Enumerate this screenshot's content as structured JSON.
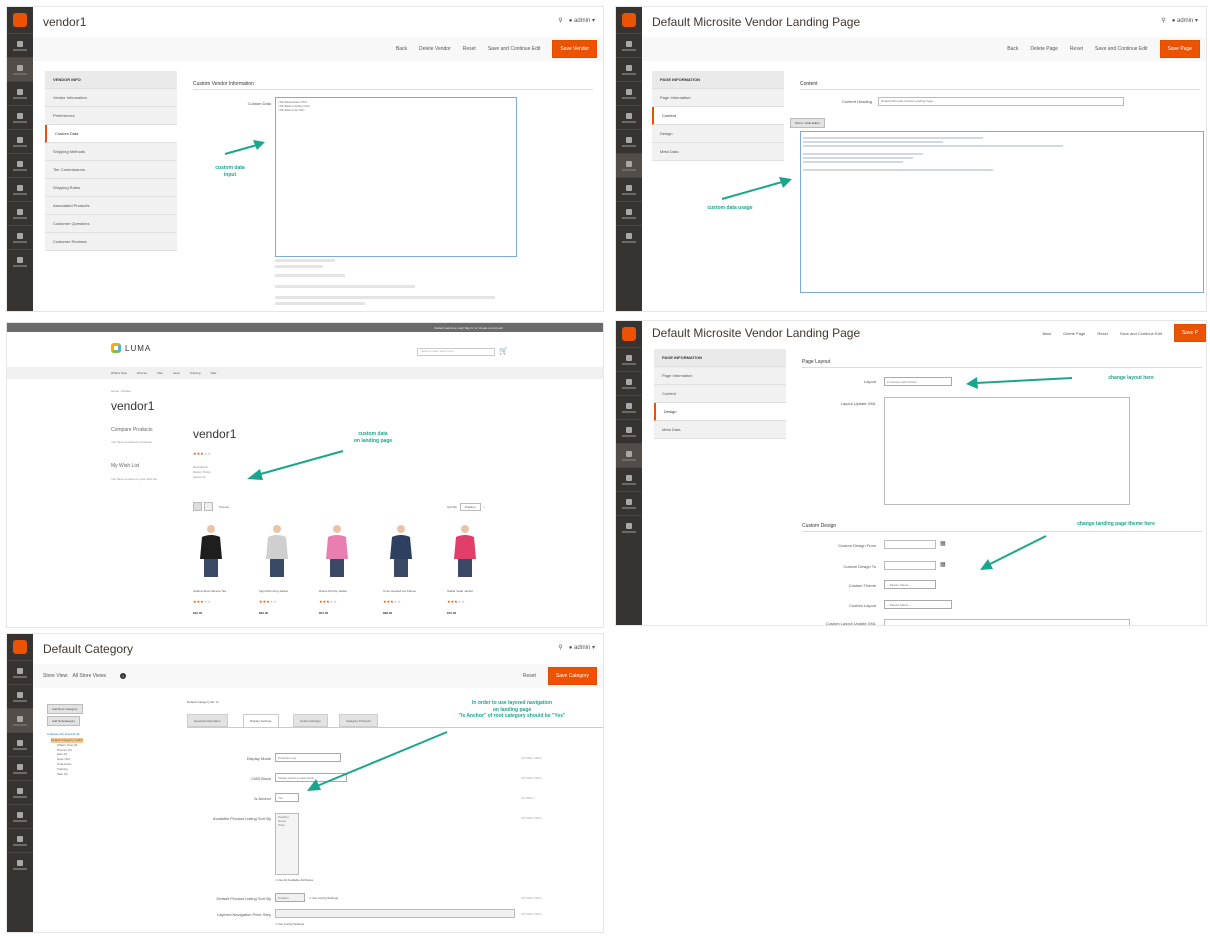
{
  "colors": {
    "accent": "#eb5202",
    "note": "#1aa68d",
    "sidebar": "#373330"
  },
  "p1": {
    "title": "vendor1",
    "actions": [
      "Back",
      "Delete Vendor",
      "Reset",
      "Save and Continue Edit",
      "Save Vendor"
    ],
    "tabs": [
      "Vendor Information",
      "Preferences",
      "Custom Data",
      "Shipping Methods",
      "Tier Commissions",
      "Shipping Rates",
      "Associated Products",
      "Customer Questions",
      "Customer Reviews"
    ],
    "section": "Custom Vendor Information",
    "field_label": "Custom Data",
    "textarea": "<h3>Description</h3>\n<h3>Return Policy</h3>\n<h3>About Us</h3>",
    "note": "custom data\ninput"
  },
  "p2": {
    "title": "Default Microsite Vendor Landing Page",
    "actions": [
      "Back",
      "Delete Page",
      "Reset",
      "Save and Continue Edit",
      "Save Page"
    ],
    "tabs": [
      "Page Information",
      "Content",
      "Design",
      "Meta Data"
    ],
    "section": "Content",
    "heading_label": "Content Heading",
    "heading_value": "Default Microsite Vendor Landing Page",
    "button": "Show / Hide Editor",
    "note": "custom data usage"
  },
  "p3": {
    "topbar": "Default welcome msg!  Sign In  or  Create an Account",
    "brand": "LUMA",
    "search_placeholder": "Search entire store here...",
    "nav": [
      "What's New",
      "Women",
      "Men",
      "Gear",
      "Training",
      "Sale"
    ],
    "breadcrumb": "Home  /  Vendor",
    "heading": "vendor1",
    "compare": "Compare Products",
    "compare_text": "You have no items to compare.",
    "wishlist": "My Wish List",
    "wishlist_text": "You have no items in your wish list.",
    "vendor_name": "vendor1",
    "custom_lines": [
      "Description",
      "Return Policy",
      "About Us"
    ],
    "items_text": "5 Items",
    "sort": "Sort By",
    "sort_value": "Position",
    "products": [
      {
        "name": "Juliana Short-Sleeve Tee",
        "price": "$42.00",
        "color": "#1e1e1e"
      },
      {
        "name": "Ingrid Running Jacket",
        "price": "$84.00",
        "color": "#cfcfcf"
      },
      {
        "name": "Riona Full Zip Jacket",
        "price": "$57.00",
        "color": "#e97fb0"
      },
      {
        "name": "Circe Hooded Ice Fleece",
        "price": "$68.00",
        "color": "#2f3f5f"
      },
      {
        "name": "Stellar Solar Jacket",
        "price": "$75.00",
        "color": "#e23e6a"
      }
    ],
    "note": "custom data\non landing page"
  },
  "p4": {
    "title": "Default Microsite Vendor Landing Page",
    "actions": [
      "Back",
      "Delete Page",
      "Reset",
      "Save and Continue Edit",
      "Save P"
    ],
    "tabs": [
      "Page Information",
      "Content",
      "Design",
      "Meta Data"
    ],
    "section1": "Page Layout",
    "layout_label": "Layout",
    "layout_value": "2 columns with left bar",
    "layout_xml_label": "Layout Update XML",
    "section2": "Custom Design",
    "design_fields": [
      "Custom Design From",
      "Custom Design To",
      "Custom Theme",
      "Custom Layout",
      "Custom Layout Update XML"
    ],
    "select_placeholder": "-- Please Select --",
    "note1": "change layout here",
    "note2": "change landing page theme here"
  },
  "p5": {
    "title": "Default Category",
    "store_view_label": "Store View:",
    "store_view_value": "All Store Views",
    "actions": [
      "Reset",
      "Save Category"
    ],
    "left_buttons": [
      "Add Root Category",
      "Add Subcategory"
    ],
    "tree_links": "Collapse All | Expand All",
    "tree": [
      "Default Category (1240)",
      "What's New (0)",
      "Women (0)",
      "Men (0)",
      "Gear (46)",
      "Collections",
      "Training",
      "Sale (0)"
    ],
    "cat_id": "Default Category (ID: 2)",
    "tabs": [
      "General Information",
      "Display Settings",
      "Custom Design",
      "Category Products"
    ],
    "fields": [
      {
        "label": "Display Mode",
        "value": "Products only",
        "scope": "[STORE VIEW]"
      },
      {
        "label": "CMS Block",
        "value": "Please select a static block",
        "scope": "[STORE VIEW]"
      },
      {
        "label": "Is Anchor",
        "value": "Yes",
        "scope": "[GLOBAL]"
      },
      {
        "label": "Available Product Listing Sort By",
        "value": "Position\nName\nPrice",
        "scope": "[STORE VIEW]"
      },
      {
        "label": "Default Product Listing Sort By",
        "value": "Position",
        "scope": "[STORE VIEW]"
      },
      {
        "label": "Layered Navigation Price Step",
        "value": "",
        "scope": "[STORE VIEW]"
      }
    ],
    "use_all": "Use All Available Attributes",
    "use_config": "Use Config Settings",
    "note": "In order to use layered navigation\non landing page\n\"Is Anchor\" of root category should be \"Yes\""
  }
}
